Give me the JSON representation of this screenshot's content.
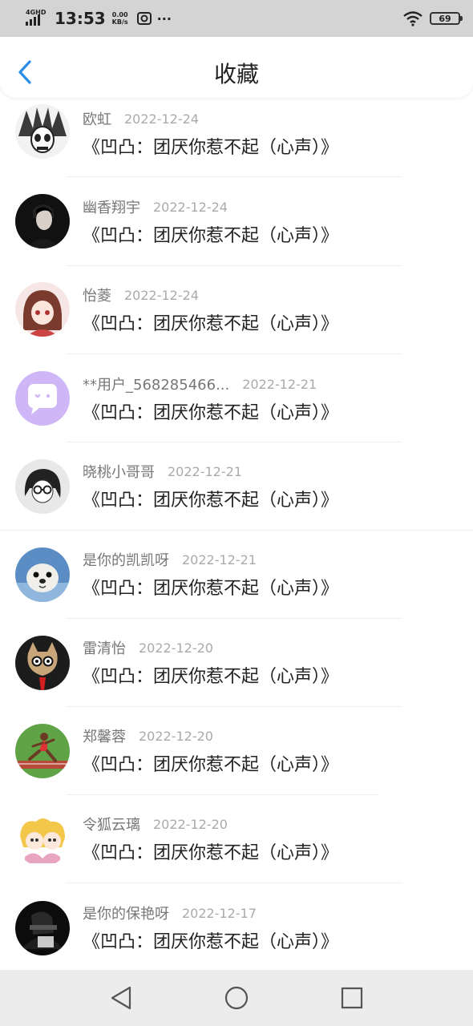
{
  "status_bar": {
    "network": "4GHD",
    "time": "13:53",
    "speed_value": "0.00",
    "speed_unit": "KB/s",
    "more": "···",
    "battery": "69",
    "icons": [
      "signal-icon",
      "camera-icon",
      "wifi-icon",
      "battery-icon"
    ]
  },
  "header": {
    "title": "收藏",
    "back_icon": "chevron-left-icon",
    "accent": "#2a8de6"
  },
  "favorites": [
    {
      "user": "欧虹",
      "date": "2022-12-24",
      "text": "《凹凸：团厌你惹不起（心声）》",
      "avatar": "skull-headdress"
    },
    {
      "user": "幽香翔宇",
      "date": "2022-12-24",
      "text": "《凹凸：团厌你惹不起（心声）》",
      "avatar": "man-portrait"
    },
    {
      "user": "怡菱",
      "date": "2022-12-24",
      "text": "《凹凸：团厌你惹不起（心声）》",
      "avatar": "anime-girl"
    },
    {
      "user": "**用户_568285466...",
      "date": "2022-12-21",
      "text": "《凹凸：团厌你惹不起（心声）》",
      "avatar": "default-chat-bubble"
    },
    {
      "user": "晓桃小哥哥",
      "date": "2022-12-21",
      "text": "《凹凸：团厌你惹不起（心声）》",
      "avatar": "sketch-character"
    },
    {
      "user": "是你的凯凯呀",
      "date": "2022-12-21",
      "text": "《凹凸：团厌你惹不起（心声）》",
      "avatar": "seal"
    },
    {
      "user": "雷清怡",
      "date": "2022-12-20",
      "text": "《凹凸：团厌你惹不起（心声）》",
      "avatar": "cat-with-glasses"
    },
    {
      "user": "郑馨蓉",
      "date": "2022-12-20",
      "text": "《凹凸：团厌你惹不起（心声）》",
      "avatar": "runner"
    },
    {
      "user": "令狐云璃",
      "date": "2022-12-20",
      "text": "《凹凸：团厌你惹不起（心声）》",
      "avatar": "anime-chibi"
    },
    {
      "user": "是你的保艳呀",
      "date": "2022-12-17",
      "text": "《凹凸：团厌你惹不起（心声）》",
      "avatar": "dark-figure"
    }
  ],
  "nav_bar": {
    "icons": [
      "back-triangle-icon",
      "home-circle-icon",
      "recents-square-icon"
    ]
  }
}
